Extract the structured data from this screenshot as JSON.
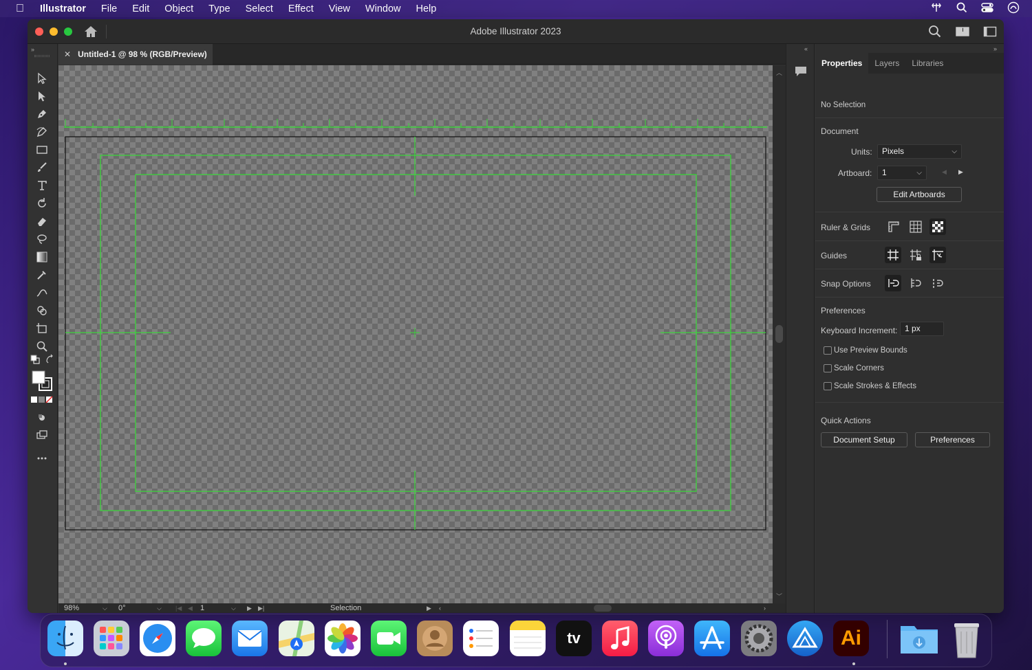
{
  "menubar": {
    "app_name": "Illustrator",
    "items": [
      "File",
      "Edit",
      "Object",
      "Type",
      "Select",
      "Effect",
      "View",
      "Window",
      "Help"
    ]
  },
  "window": {
    "title": "Adobe Illustrator 2023",
    "doc_tab": "Untitled-1 @ 98 % (RGB/Preview)"
  },
  "statusbar": {
    "zoom": "98%",
    "rotation": "0°",
    "artboard": "1",
    "tool": "Selection"
  },
  "properties": {
    "tabs": [
      "Properties",
      "Layers",
      "Libraries"
    ],
    "no_selection": "No Selection",
    "document_label": "Document",
    "units_label": "Units:",
    "units_value": "Pixels",
    "artboard_label": "Artboard:",
    "artboard_value": "1",
    "edit_artboards": "Edit Artboards",
    "ruler_grids": "Ruler & Grids",
    "guides": "Guides",
    "snap_options": "Snap Options",
    "preferences_label": "Preferences",
    "keyboard_increment_label": "Keyboard Increment:",
    "keyboard_increment_value": "1 px",
    "checkboxes": [
      "Use Preview Bounds",
      "Scale Corners",
      "Scale Strokes & Effects"
    ],
    "quick_actions": "Quick Actions",
    "document_setup": "Document Setup",
    "preferences_button": "Preferences"
  },
  "colors": {
    "guide_green": "#3cd43c",
    "panel_bg": "#2f2f2f"
  },
  "dock": {
    "apps": [
      "finder-icon",
      "launchpad-icon",
      "safari-icon",
      "messages-icon",
      "mail-icon",
      "maps-icon",
      "photos-icon",
      "facetime-icon",
      "contacts-icon",
      "reminders-icon",
      "notes-icon",
      "appletv-icon",
      "music-icon",
      "podcasts-icon",
      "appstore-icon",
      "system-settings-icon",
      "altstore-icon",
      "illustrator-icon",
      "downloads-folder-icon",
      "trash-icon"
    ],
    "appletv_label": "tv",
    "illustrator_label": "Ai"
  }
}
